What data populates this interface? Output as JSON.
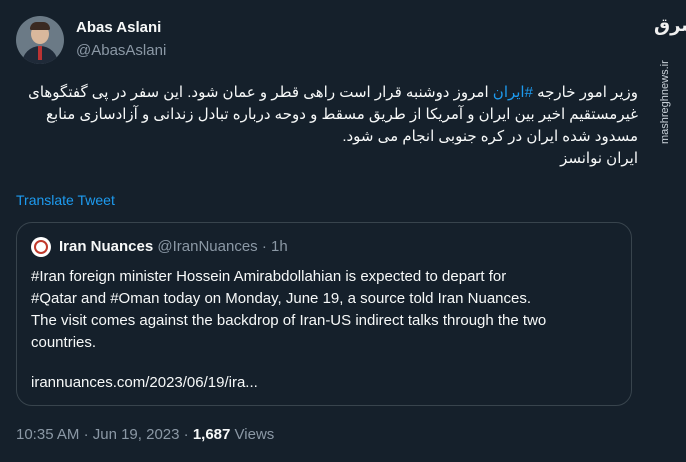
{
  "author": {
    "display_name": "Abas Aslani",
    "handle": "@AbasAslani"
  },
  "more_icon": "more-horizontal-icon",
  "tweet_lines": [
    {
      "before": "وزیر امور خارجه ",
      "hashtag": "#ایران",
      "after": " امروز دوشنبه قرار است راهی قطر و عمان شود. این سفر در پی گفتگوهای"
    },
    {
      "before": "غیرمستقیم اخیر بین ایران و آمریکا از طریق مسقط و دوحه درباره تبادل زندانی و آزادسازی منابع",
      "hashtag": "",
      "after": ""
    },
    {
      "before": "مسدود شده ایران در کره جنوبی انجام می شود.",
      "hashtag": "",
      "after": ""
    },
    {
      "before": "ایران نوانسز",
      "hashtag": "",
      "after": ""
    }
  ],
  "translate_label": "Translate Tweet",
  "quote": {
    "display_name": "Iran Nuances",
    "handle": "@IranNuances",
    "separator": "·",
    "time": "1h",
    "lines": [
      "#Iran foreign minister Hossein Amirabdollahian is expected to depart for",
      "#Qatar and #Oman today on Monday, June 19, a source told Iran Nuances.",
      "The visit comes against the backdrop of Iran-US indirect talks through the two",
      "countries."
    ],
    "link": "irannuances.com/2023/06/19/ira..."
  },
  "meta": {
    "time": "10:35 AM",
    "separator": "·",
    "date": "Jun 19, 2023",
    "separator2": "·",
    "views_count": "1,687",
    "views_label": "Views"
  },
  "watermark": {
    "logo": "مشرق",
    "text": "mashreghnews.ir"
  }
}
